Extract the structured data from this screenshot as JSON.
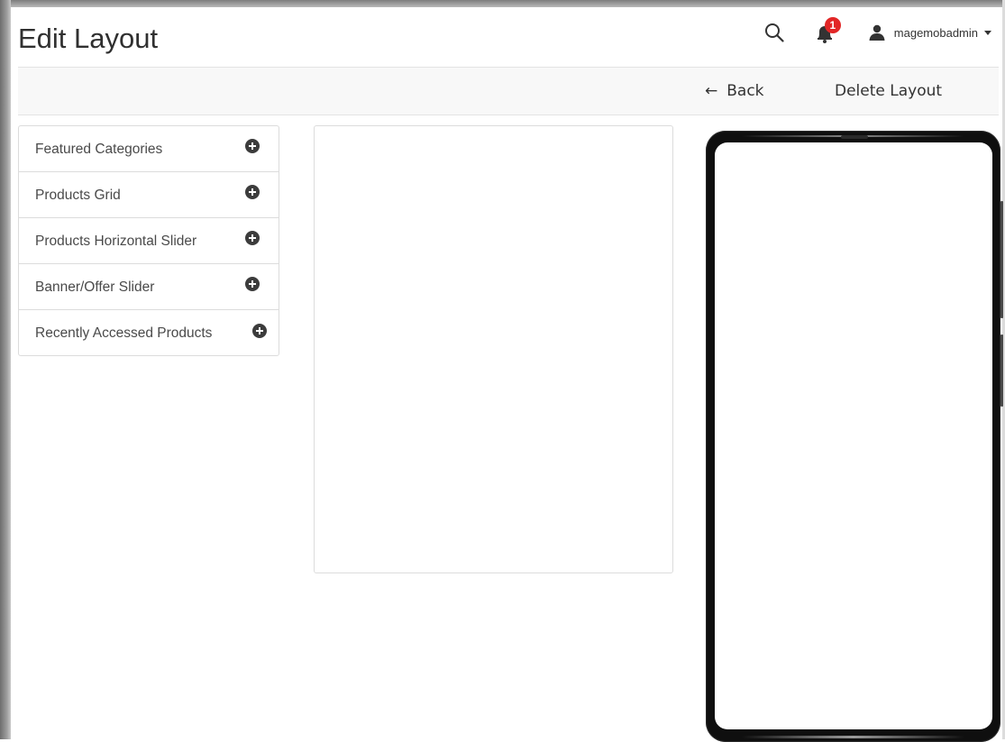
{
  "header": {
    "title": "Edit Layout",
    "notifications": {
      "count": "1"
    },
    "user": {
      "name": "magemobadmin"
    }
  },
  "toolbar": {
    "back_label": "Back",
    "back_arrow": "←",
    "delete_label": "Delete Layout"
  },
  "components": {
    "items": [
      {
        "label": "Featured Categories",
        "icon": "add-circle-icon"
      },
      {
        "label": "Products Grid",
        "icon": "add-circle-icon"
      },
      {
        "label": "Products Horizontal Slider",
        "icon": "add-circle-icon"
      },
      {
        "label": "Banner/Offer Slider",
        "icon": "add-circle-icon"
      },
      {
        "label": "Recently Accessed Products",
        "icon": "add-circle-icon"
      }
    ]
  },
  "colors": {
    "badge": "#e22626",
    "toolbar_bg": "#f8f8f8",
    "border": "#dcdcdc",
    "phone_frame": "#0f0f0f"
  }
}
